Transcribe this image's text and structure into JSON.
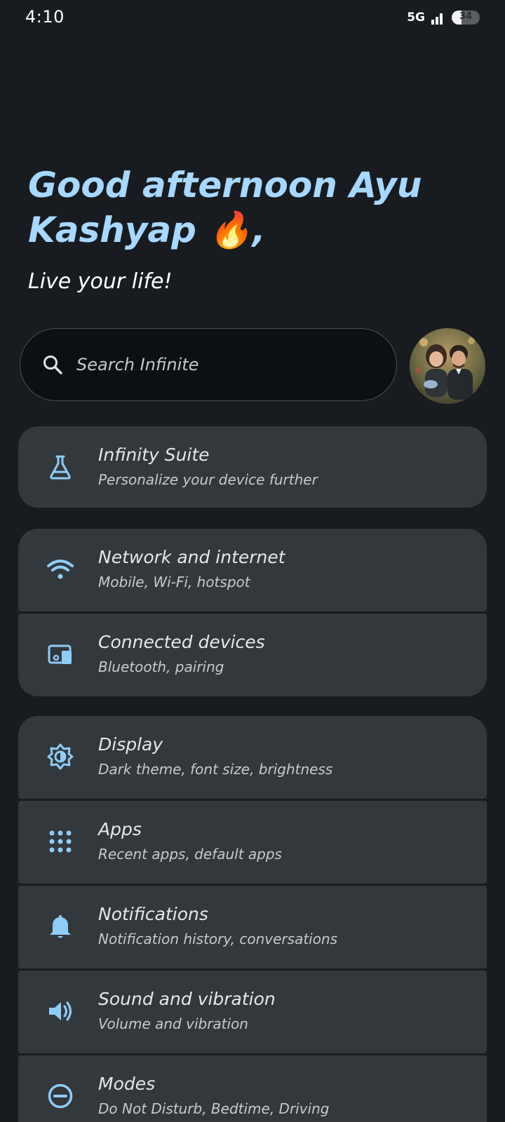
{
  "status_bar": {
    "time": "4:10",
    "network": "5G",
    "battery_level": "34",
    "battery_fraction": 0.34
  },
  "header": {
    "greeting_line1": "Good afternoon Ayu",
    "greeting_line2": "Kashyap 🔥,",
    "subtitle": "Live your life!"
  },
  "search": {
    "placeholder": "Search Infinite",
    "icon": "search-icon"
  },
  "avatar": {
    "icon": "profile-avatar"
  },
  "colors": {
    "background": "#181c20",
    "card": "#33383d",
    "accent": "#a8d8ff",
    "icon": "#8fcdf7"
  },
  "settings": [
    {
      "title": "Infinity Suite",
      "subtitle": "Personalize your device further",
      "icon": "flask-icon"
    },
    {
      "title": "Network and internet",
      "subtitle": "Mobile, Wi-Fi, hotspot",
      "icon": "wifi-icon"
    },
    {
      "title": "Connected devices",
      "subtitle": "Bluetooth, pairing",
      "icon": "devices-icon"
    },
    {
      "title": "Display",
      "subtitle": "Dark theme, font size, brightness",
      "icon": "brightness-icon"
    },
    {
      "title": "Apps",
      "subtitle": "Recent apps, default apps",
      "icon": "apps-grid-icon"
    },
    {
      "title": "Notifications",
      "subtitle": "Notification history, conversations",
      "icon": "bell-icon"
    },
    {
      "title": "Sound and vibration",
      "subtitle": "Volume and vibration",
      "icon": "speaker-icon"
    },
    {
      "title": "Modes",
      "subtitle": "Do Not Disturb, Bedtime, Driving",
      "icon": "minus-circle-icon"
    }
  ]
}
